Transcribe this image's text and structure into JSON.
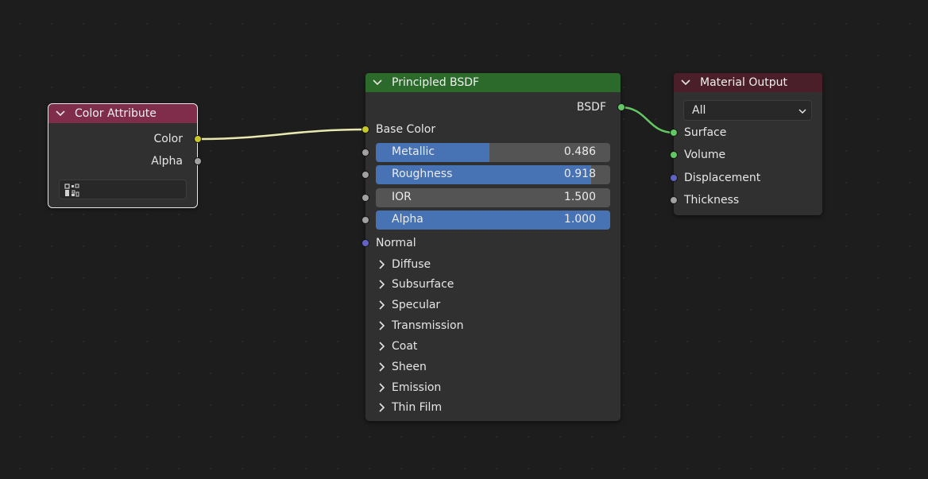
{
  "nodes": {
    "color_attribute": {
      "title": "Color Attribute",
      "header_color": "#7f2d4a",
      "outputs": [
        "Color",
        "Alpha"
      ],
      "attribute_value": ""
    },
    "principled": {
      "title": "Principled BSDF",
      "header_color": "#2b6a2b",
      "output": "BSDF",
      "base_color_label": "Base Color",
      "sliders": [
        {
          "label": "Metallic",
          "value": "0.486",
          "fraction": 0.486
        },
        {
          "label": "Roughness",
          "value": "0.918",
          "fraction": 0.918
        },
        {
          "label": "IOR",
          "value": "1.500",
          "fraction": 0
        },
        {
          "label": "Alpha",
          "value": "1.000",
          "fraction": 1.0
        }
      ],
      "normal_label": "Normal",
      "panels": [
        "Diffuse",
        "Subsurface",
        "Specular",
        "Transmission",
        "Coat",
        "Sheen",
        "Emission",
        "Thin Film"
      ]
    },
    "material_output": {
      "title": "Material Output",
      "header_color": "#4a1f29",
      "target_value": "All",
      "inputs": [
        "Surface",
        "Volume",
        "Displacement",
        "Thickness"
      ]
    }
  },
  "colors": {
    "canvas": "#1d1d1d",
    "node_body": "#303030",
    "slider_fill": "#4772b3",
    "socket_color": "#c7c729",
    "socket_float": "#a1a1a1",
    "socket_shader": "#63c763",
    "socket_vector": "#6363c7",
    "link_color": "#e8e8b0",
    "link_shader": "#63c763"
  },
  "icons": [
    "chevron-down-icon",
    "chevron-right-icon",
    "color-attribute-icon",
    "dropdown-arrow-icon"
  ]
}
